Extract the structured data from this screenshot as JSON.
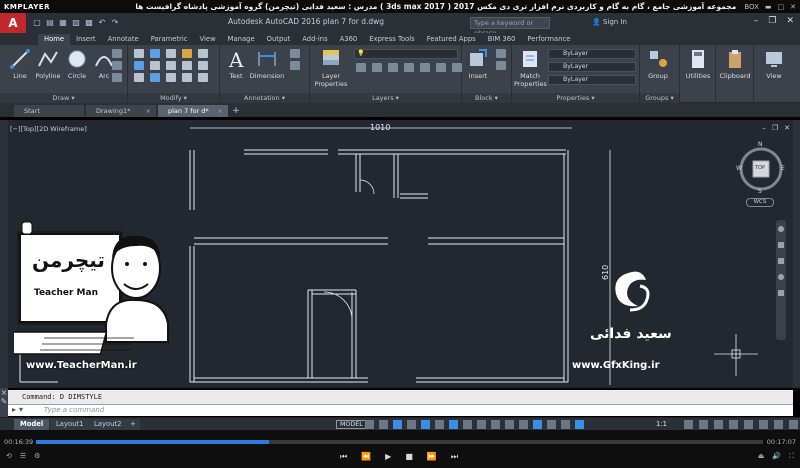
{
  "player": {
    "logo": "KMPLAYER",
    "title": "مجموعه آموزشی جامع ، گام به گام و کاربردی نرم افزار تری دی مکس 2017 ( 3ds max 2017 )    مدرس : سعید فدایی (تیچرمن) گروه آموزشی پادشاه گرافیست ها",
    "box_label": "BOX",
    "time_elapsed": "00:16:39",
    "time_total": "00:17:07",
    "progress": 0.32
  },
  "acad": {
    "app_letter": "A",
    "title": "Autodesk AutoCAD 2016    plan 7 for d.dwg",
    "search_placeholder": "Type a keyword or phrase",
    "sign_in": "Sign In"
  },
  "ribbon_tabs": [
    "Home",
    "Insert",
    "Annotate",
    "Parametric",
    "View",
    "Manage",
    "Output",
    "Add-ins",
    "A360",
    "Express Tools",
    "Featured Apps",
    "BIM 360",
    "Performance"
  ],
  "panels": {
    "draw": {
      "label": "Draw ▾",
      "tools": [
        "Line",
        "Polyline",
        "Circle",
        "Arc"
      ]
    },
    "modify": {
      "label": "Modify ▾"
    },
    "annotation": {
      "label": "Annotation ▾",
      "tools": [
        "Text",
        "Dimension"
      ]
    },
    "layers": {
      "label": "Layers ▾",
      "tool": "Layer Properties"
    },
    "block": {
      "label": "Block ▾",
      "tool": "Insert"
    },
    "properties": {
      "label": "Properties ▾",
      "tool": "Match Properties",
      "rows": [
        "ByLayer",
        "ByLayer",
        "ByLayer"
      ]
    },
    "groups": {
      "label": "Groups ▾",
      "tool": "Group"
    },
    "utilities": {
      "tool": "Utilities"
    },
    "clipboard": {
      "tool": "Clipboard"
    },
    "view": {
      "tool": "View"
    }
  },
  "file_tabs": [
    "Start",
    "Drawing1*",
    "plan 7 for d*"
  ],
  "viewport": {
    "label": "[−][Top][2D Wireframe]",
    "dim_horizontal": "1010",
    "dim_vertical": "610",
    "nav_top": "TOP",
    "compass": [
      "N",
      "E",
      "S",
      "W"
    ],
    "wcs": "WCS"
  },
  "watermark": {
    "brand_left": "تیچرمن",
    "subtitle_left": "Teacher Man",
    "url_left": "www.TeacherMan.ir",
    "name_right": "سعید فدائی",
    "url_right": "www.GfxKing.ir"
  },
  "command": {
    "history": "Command: D DIMSTYLE",
    "placeholder": "Type a command"
  },
  "status": {
    "tabs": [
      "Model",
      "Layout1",
      "Layout2"
    ],
    "model_btn": "MODEL",
    "scale": "1:1"
  }
}
